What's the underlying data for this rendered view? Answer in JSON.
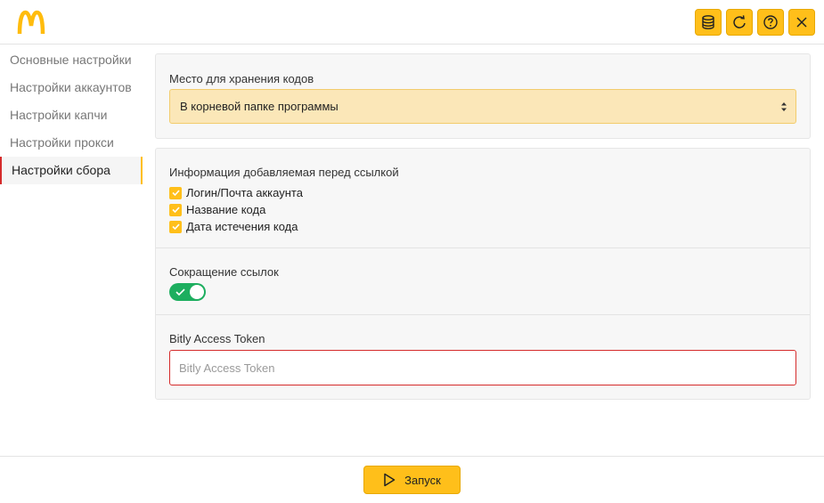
{
  "colors": {
    "accent": "#ffbf1a",
    "danger": "#d52b2b",
    "toggle_on": "#1dae5f"
  },
  "header": {
    "logo_icon": "mcdonalds-arches-logo",
    "buttons": [
      {
        "icon": "database-icon"
      },
      {
        "icon": "refresh-icon"
      },
      {
        "icon": "help-icon"
      },
      {
        "icon": "close-icon"
      }
    ]
  },
  "sidebar": {
    "items": [
      {
        "label": "Основные настройки",
        "active": false
      },
      {
        "label": "Настройки аккаунтов",
        "active": false
      },
      {
        "label": "Настройки капчи",
        "active": false
      },
      {
        "label": "Настройки прокси",
        "active": false
      },
      {
        "label": "Настройки сбора",
        "active": true
      }
    ]
  },
  "storage": {
    "label": "Место для хранения кодов",
    "selected": "В корневой папке программы"
  },
  "link_info": {
    "label": "Информация добавляемая перед ссылкой",
    "options": [
      {
        "label": "Логин/Почта аккаунта",
        "checked": true
      },
      {
        "label": "Название кода",
        "checked": true
      },
      {
        "label": "Дата истечения кода",
        "checked": true
      }
    ]
  },
  "shortening": {
    "label": "Сокращение ссылок",
    "enabled": true
  },
  "bitly": {
    "label": "Bitly Access Token",
    "placeholder": "Bitly Access Token",
    "value": ""
  },
  "footer": {
    "run_label": "Запуск"
  }
}
